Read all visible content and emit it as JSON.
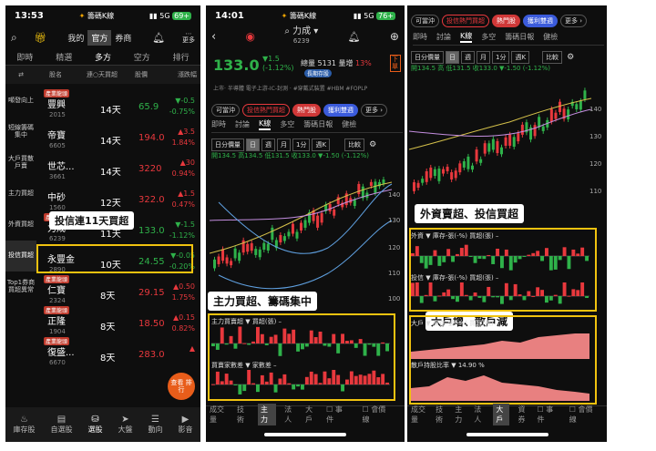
{
  "p1": {
    "time": "13:53",
    "title": "籌碼K線",
    "signal": "5G",
    "battery": "69+",
    "toptabs": [
      "我的",
      "官方",
      "券商"
    ],
    "more": "更多",
    "cats": [
      "即時",
      "精選",
      "多方",
      "空方",
      "排行"
    ],
    "headers": [
      "股名",
      "連○天買超",
      "股價",
      "漲跌幅"
    ],
    "side": [
      "噸發向上",
      "短線籌碼集中",
      "大戶買散戶賣",
      "主力買超",
      "外資買超",
      "投信買超",
      "Top1券商買超異常"
    ],
    "rows": [
      {
        "tag": "產業龍頭",
        "name": "豐興",
        "code": "2015",
        "days": "14天",
        "price": "65.9",
        "chg1": "▼-0.5",
        "chg2": "-0.75%",
        "col": "grn"
      },
      {
        "tag": "",
        "name": "帝寶",
        "code": "6605",
        "days": "14天",
        "price": "194.0",
        "chg1": "▲3.5",
        "chg2": "1.84%",
        "col": "red"
      },
      {
        "tag": "",
        "name": "世芯...",
        "code": "3661",
        "days": "14天",
        "price": "3220",
        "chg1": "▲30",
        "chg2": "0.94%",
        "col": "red"
      },
      {
        "tag": "",
        "name": "中砂",
        "code": "1560",
        "days": "12天",
        "price": "322.0",
        "chg1": "▲1.5",
        "chg2": "0.47%",
        "col": "red"
      },
      {
        "tag": "產業龍頭",
        "name": "力成",
        "code": "6239",
        "days": "11天",
        "price": "133.0",
        "chg1": "▼-1.5",
        "chg2": "-1.12%",
        "col": "grn"
      },
      {
        "tag": "",
        "name": "永豐金",
        "code": "2890",
        "days": "10天",
        "price": "24.55",
        "chg1": "▼-0.05",
        "chg2": "-0.20%",
        "col": "grn"
      },
      {
        "tag": "產業龍頭",
        "name": "仁寶",
        "code": "2324",
        "days": "8天",
        "price": "29.15",
        "chg1": "▲0.50",
        "chg2": "1.75%",
        "col": "red"
      },
      {
        "tag": "產業龍頭",
        "name": "正隆",
        "code": "1904",
        "days": "8天",
        "price": "18.50",
        "chg1": "▲0.15",
        "chg2": "0.82%",
        "col": "red"
      },
      {
        "tag": "產業龍頭",
        "name": "復盛...",
        "code": "6670",
        "days": "8天",
        "price": "283.0",
        "chg1": "▲",
        "chg2": "",
        "col": "red"
      }
    ],
    "annotation": "投信連11天買超",
    "fab": "查看 排行",
    "nav": [
      "庫存股",
      "自選股",
      "選股",
      "大盤",
      "動向",
      "影音"
    ]
  },
  "p2": {
    "time": "14:01",
    "title": "籌碼K線",
    "signal": "5G",
    "battery": "76+",
    "stock": "力成",
    "code": "6239",
    "price": "133.0",
    "chg": "▼1.5",
    "pct": "(-1.12%)",
    "vol_label": "總量",
    "vol": "5131",
    "amp_label": "量增",
    "amp": "13%",
    "market": "上市",
    "tags": "‧ 半導體 電子上游-IC-封測 ‧ #穿戴式裝置 #HBM #FOPLP",
    "long_badge": "長期存股",
    "order": "下單",
    "chips": [
      "可當沖",
      "投信熱門買超",
      "熱門股",
      "獲利雙週",
      "更多 ›"
    ],
    "tabs": [
      "即時",
      "討論",
      "K線",
      "多空",
      "籌碼日報",
      "健檢"
    ],
    "ctrls": [
      "日分價量",
      "日",
      "週",
      "月",
      "1分",
      "週K"
    ],
    "cmp": "比較",
    "ohlc": "開134.5 高134.5 低131.5 收133.0 ▼-1.50 (-1.12%)",
    "axis": [
      "140",
      "130",
      "120",
      "110",
      "100"
    ],
    "annotation": "主力買超、籌碼集中",
    "ind1": "主力買賣超 ▼  買超(張) –",
    "ind2": "買賣家數差 ▼  家數差 –",
    "btm": [
      "成交量",
      "技術",
      "主力",
      "法人",
      "大戶",
      "事件",
      "會價線"
    ]
  },
  "p3": {
    "chips": [
      "可當沖",
      "投信熱門買超",
      "熱門股",
      "獲利雙週",
      "更多 ›"
    ],
    "tabs": [
      "即時",
      "討論",
      "K線",
      "多空",
      "籌碼日報",
      "健檢"
    ],
    "ctrls": [
      "日分價量",
      "日",
      "週",
      "月",
      "1分",
      "週K"
    ],
    "cmp": "比較",
    "ohlc": "開134.5 高 低131.5 收133.0 ▼-1.50 (-1.12%)",
    "axis": [
      "140",
      "130",
      "120",
      "110"
    ],
    "annotation1": "外資賣超、投信買超",
    "annotation2": "大戶增、散戶減",
    "ind1": "外資 ▼ 庫存-張(-%) 買超(張) –",
    "ind2": "投信 ▼ 庫存-張(-%) 買超(張) –",
    "ind3": "大戶 ▼ 庫存-張(-%) 買超(張) –",
    "ind4": "散戶持股比率 ▼  14.90 %",
    "btm": [
      "成交量",
      "技術",
      "主力",
      "法人",
      "大戶",
      "資券",
      "事件",
      "會價線"
    ]
  },
  "chart_data": [
    {
      "type": "line",
      "title": "力成 6239 日K",
      "ylim": [
        100,
        145
      ],
      "x": [
        "",
        "",
        "",
        "",
        "",
        "",
        "",
        "",
        "",
        "",
        "",
        ""
      ],
      "series": [
        {
          "name": "收盤",
          "values": [
            112,
            108,
            104,
            106,
            111,
            115,
            118,
            125,
            128,
            131,
            134,
            133
          ]
        }
      ]
    }
  ]
}
